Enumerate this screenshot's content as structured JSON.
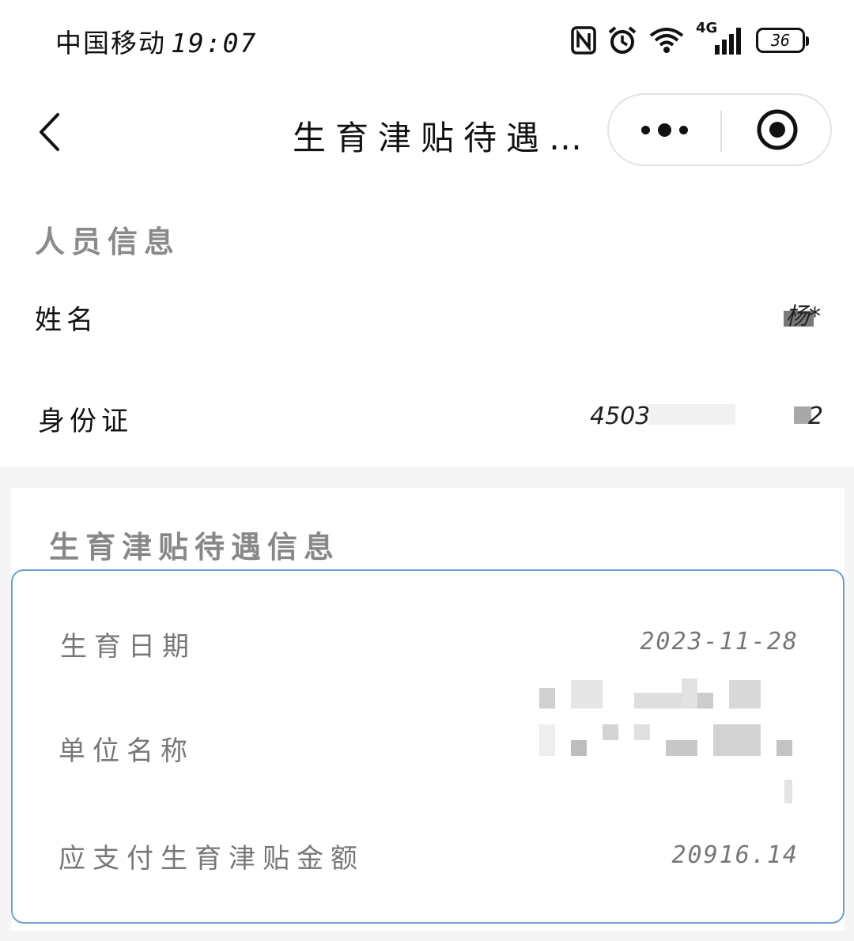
{
  "status_bar": {
    "carrier": "中国移动",
    "time": "19:07",
    "network": "4G",
    "battery": "36"
  },
  "nav": {
    "title": "生育津贴待遇…"
  },
  "person": {
    "section_title": "人员信息",
    "name_label": "姓名",
    "name_value": "杨*",
    "id_label": "身份证",
    "id_value_prefix": "4503",
    "id_value_suffix": "2"
  },
  "benefit": {
    "section_title": "生育津贴待遇信息",
    "birth_date_label": "生育日期",
    "birth_date_value": "2023-11-28",
    "employer_label": "单位名称",
    "amount_label": "应支付生育津贴金额",
    "amount_value": "20916.14"
  },
  "colors": {
    "accent_border": "#6a9fd8",
    "label_gray": "#777777",
    "page_bg": "#f5f5f5"
  }
}
